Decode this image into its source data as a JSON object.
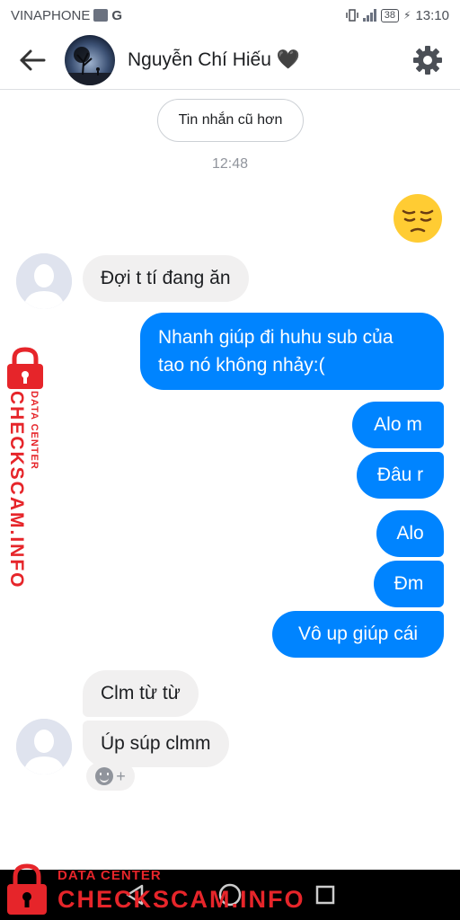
{
  "status_bar": {
    "carrier": "VINAPHONE",
    "network": "G",
    "battery": "38",
    "time": "13:10"
  },
  "header": {
    "contact_name": "Nguyễn Chí Hiếu 🖤",
    "back_icon": "arrow-left-icon",
    "settings_icon": "gear-icon"
  },
  "thread": {
    "older_messages_label": "Tin nhắn cũ hơn",
    "timestamp": "12:48",
    "emoji": "pensive-face",
    "messages": [
      {
        "side": "in",
        "text": "Đợi t tí đang ăn"
      },
      {
        "side": "out",
        "text": "Nhanh giúp đi huhu sub của"
      },
      {
        "side": "out",
        "text": "tao nó không nhảy:("
      },
      {
        "side": "out",
        "text": "Alo m"
      },
      {
        "side": "out",
        "text": "Đâu r"
      },
      {
        "side": "out",
        "text": "Alo"
      },
      {
        "side": "out",
        "text": "Đm"
      },
      {
        "side": "out",
        "text": "Vô up giúp cái"
      },
      {
        "side": "in",
        "text": "Clm từ từ"
      },
      {
        "side": "in",
        "text": "Úp súp clmm"
      }
    ],
    "reaction_plus": "+"
  },
  "watermark": {
    "brand": "CHECKSCAM.INFO",
    "sub": "DATA CENTER"
  },
  "colors": {
    "outgoing": "#0084ff",
    "incoming": "#f1f0f0",
    "watermark": "#e6252a"
  }
}
